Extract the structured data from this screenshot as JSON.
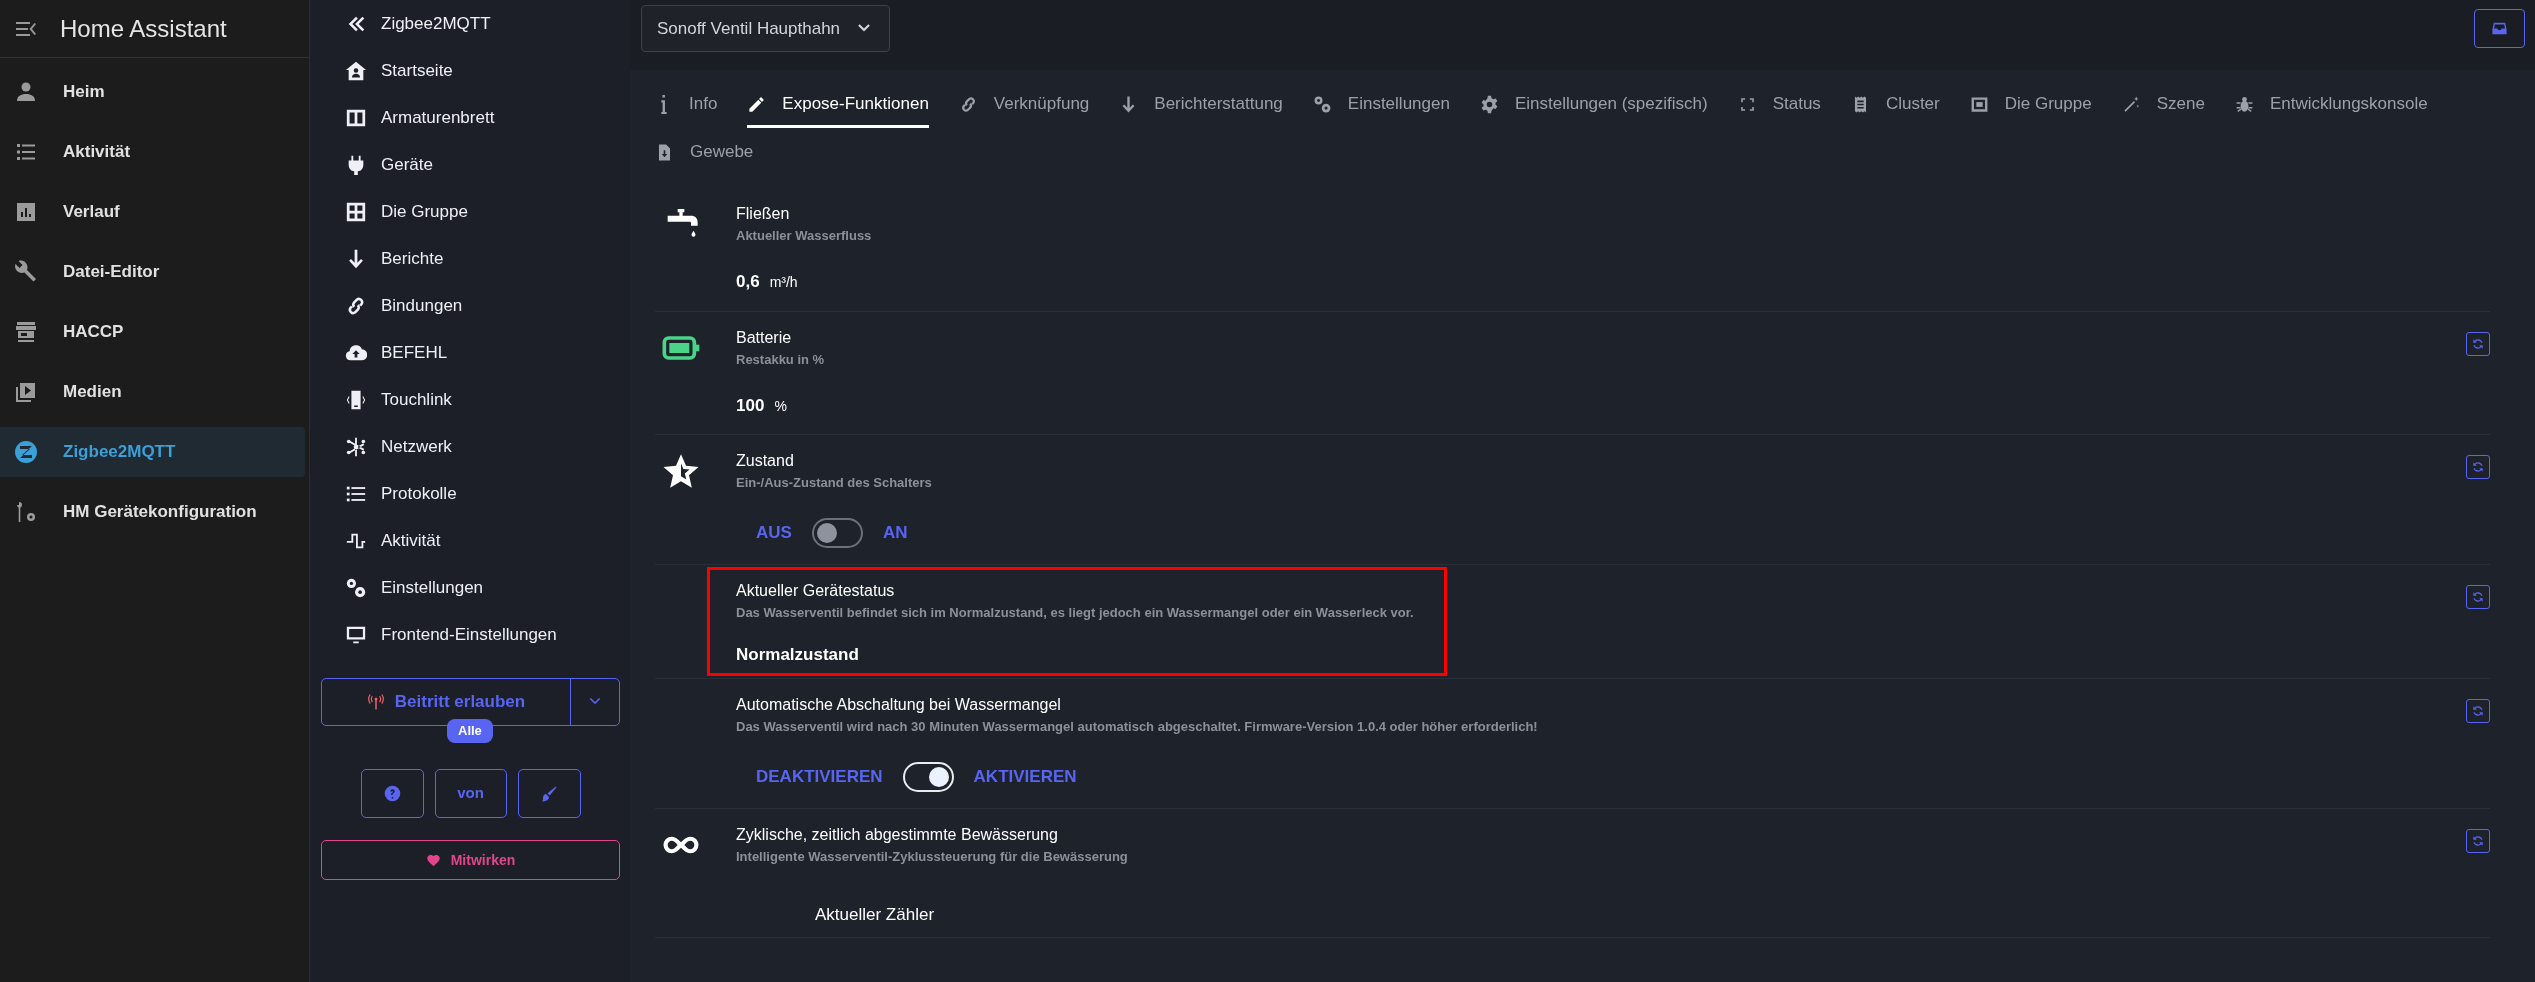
{
  "ha_sidebar": {
    "title": "Home Assistant",
    "items": [
      {
        "label": "Heim",
        "selected": false
      },
      {
        "label": "Aktivität",
        "selected": false
      },
      {
        "label": "Verlauf",
        "selected": false
      },
      {
        "label": "Datei-Editor",
        "selected": false
      },
      {
        "label": "HACCP",
        "selected": false
      },
      {
        "label": "Medien",
        "selected": false
      },
      {
        "label": "Zigbee2MQTT",
        "selected": true
      },
      {
        "label": "HM Gerätekonfiguration",
        "selected": false
      }
    ]
  },
  "z2m_nav": {
    "back_label": "Zigbee2MQTT",
    "items": [
      "Startseite",
      "Armaturenbrett",
      "Geräte",
      "Die Gruppe",
      "Berichte",
      "Bindungen",
      "BEFEHL",
      "Touchlink",
      "Netzwerk",
      "Protokolle",
      "Aktivität",
      "Einstellungen",
      "Frontend-Einstellungen"
    ],
    "permit_join": {
      "label": "Beitritt erlauben",
      "badge": "Alle"
    },
    "small_buttons": [
      {
        "kind": "help"
      },
      {
        "kind": "text",
        "label": "von"
      },
      {
        "kind": "theme"
      }
    ],
    "contribute": "Mitwirken"
  },
  "device_select": {
    "value": "Sonoff Ventil Haupthahn"
  },
  "tabs": [
    {
      "label": "Info",
      "selected": false
    },
    {
      "label": "Expose-Funktionen",
      "selected": true
    },
    {
      "label": "Verknüpfung",
      "selected": false
    },
    {
      "label": "Berichterstattung",
      "selected": false
    },
    {
      "label": "Einstellungen",
      "selected": false
    },
    {
      "label": "Einstellungen (spezifisch)",
      "selected": false
    },
    {
      "label": "Status",
      "selected": false
    },
    {
      "label": "Cluster",
      "selected": false
    },
    {
      "label": "Die Gruppe",
      "selected": false
    },
    {
      "label": "Szene",
      "selected": false
    },
    {
      "label": "Entwicklungskonsole",
      "selected": false
    },
    {
      "label": "Gewebe",
      "selected": false
    }
  ],
  "features": [
    {
      "kind": "numeric",
      "title": "Fließen",
      "description": "Aktueller Wasserfluss",
      "value": "0,6",
      "unit": "m³/h",
      "refresh": false,
      "highlighted": false
    },
    {
      "kind": "numeric",
      "title": "Batterie",
      "description": "Restakku in %",
      "value": "100",
      "unit": "%",
      "refresh": true,
      "highlighted": false
    },
    {
      "kind": "binary",
      "title": "Zustand",
      "description": "Ein-/Aus-Zustand des Schalters",
      "off_label": "AUS",
      "on_label": "AN",
      "on": false,
      "refresh": true,
      "highlighted": false
    },
    {
      "kind": "enum",
      "title": "Aktueller Gerätestatus",
      "description": "Das Wasserventil befindet sich im Normalzustand, es liegt jedoch ein Wassermangel oder ein Wasserleck vor.",
      "value": "Normalzustand",
      "refresh": true,
      "highlighted": true
    },
    {
      "kind": "binary",
      "title": "Automatische Abschaltung bei Wassermangel",
      "description": "Das Wasserventil wird nach 30 Minuten Wassermangel automatisch abgeschaltet. Firmware-Version 1.0.4 oder höher erforderlich!",
      "off_label": "DEAKTIVIEREN",
      "on_label": "AKTIVIEREN",
      "on": true,
      "refresh": true,
      "highlighted": false
    },
    {
      "kind": "composite",
      "title": "Zyklische, zeitlich abgestimmte Bewässerung",
      "description": "Intelligente Wasserventil-Zyklussteuerung für die Bewässerung",
      "sub_label": "Aktueller Zähler",
      "refresh": true,
      "highlighted": false
    }
  ]
}
